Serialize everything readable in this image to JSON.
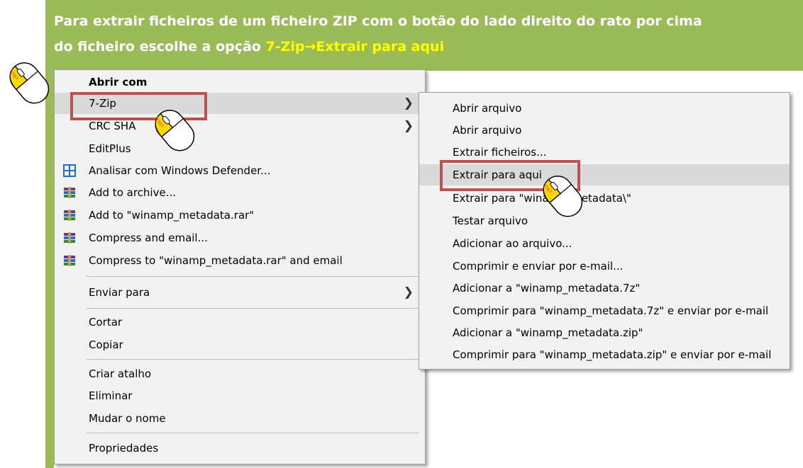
{
  "banner": {
    "line1": "Para extrair ficheiros de um ficheiro ZIP com o botão do lado direito do rato por cima",
    "line2_prefix": "do ficheiro escolhe a opção ",
    "line2_highlight": "7-Zip→Extrair para aqui"
  },
  "context_menu": {
    "items": [
      {
        "label": "Abrir com"
      },
      {
        "label": "7-Zip"
      },
      {
        "label": "CRC SHA"
      },
      {
        "label": "EditPlus"
      },
      {
        "label": "Analisar com Windows Defender..."
      },
      {
        "label": "Add to archive..."
      },
      {
        "label": "Add to \"winamp_metadata.rar\""
      },
      {
        "label": "Compress and email..."
      },
      {
        "label": "Compress to \"winamp_metadata.rar\" and email"
      },
      {
        "label": "Enviar para"
      },
      {
        "label": "Cortar"
      },
      {
        "label": "Copiar"
      },
      {
        "label": "Criar atalho"
      },
      {
        "label": "Eliminar"
      },
      {
        "label": "Mudar o nome"
      },
      {
        "label": "Propriedades"
      }
    ]
  },
  "submenu_7zip": {
    "items": [
      {
        "label": "Abrir arquivo"
      },
      {
        "label": "Abrir arquivo"
      },
      {
        "label": "Extrair ficheiros..."
      },
      {
        "label": "Extrair para aqui"
      },
      {
        "label": "Extrair para \"winamp_metadata\\\""
      },
      {
        "label": "Testar arquivo"
      },
      {
        "label": "Adicionar ao arquivo..."
      },
      {
        "label": "Comprimir e enviar por e-mail..."
      },
      {
        "label": "Adicionar a \"winamp_metadata.7z\""
      },
      {
        "label": "Comprimir para \"winamp_metadata.7z\" e enviar por e-mail"
      },
      {
        "label": "Adicionar a \"winamp_metadata.zip\""
      },
      {
        "label": "Comprimir para \"winamp_metadata.zip\" e enviar por e-mail"
      }
    ]
  },
  "mouse_click_label": "click",
  "colors": {
    "banner": "#9bbb59",
    "highlight_text": "#ffff00",
    "red_box": "#b85450",
    "hover": "#dadada"
  }
}
